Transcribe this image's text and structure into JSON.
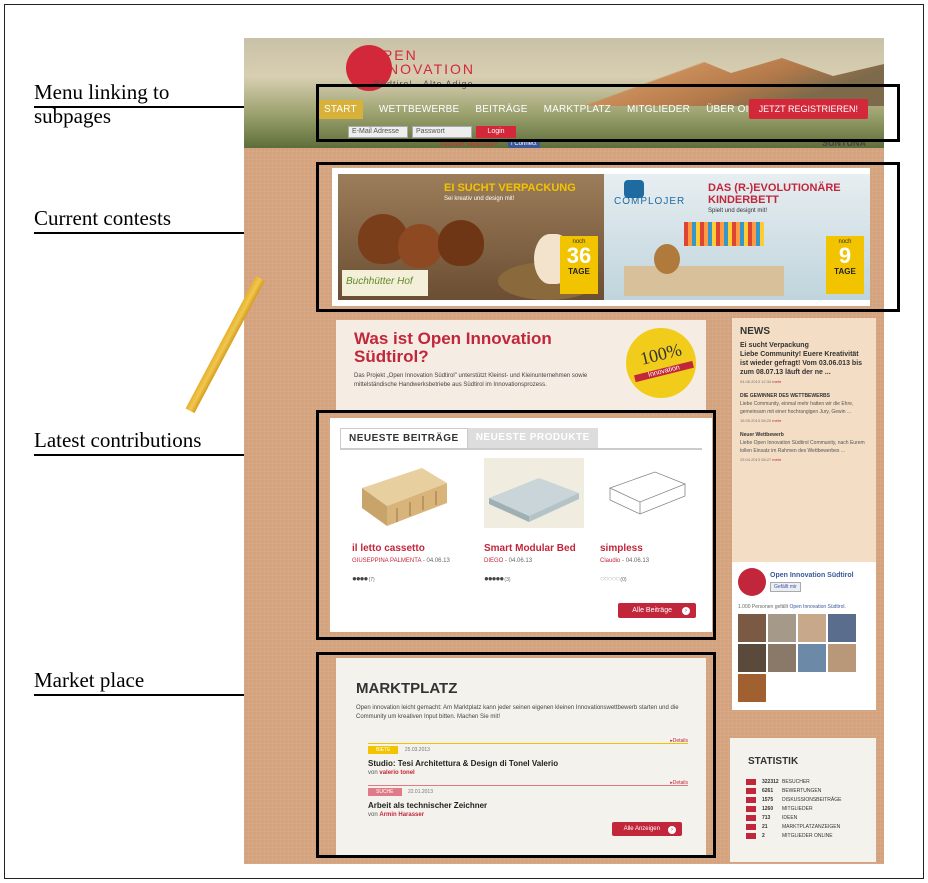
{
  "callouts": {
    "menu": "Menu linking to subpages",
    "contests": "Current contests",
    "contributions": "Latest contributions",
    "market": "Market place"
  },
  "header": {
    "logo_line1": "OPEN",
    "logo_line2": "INNOVATION",
    "logo_sub": "Südtirol - Alto Adige",
    "nav": [
      "START",
      "WETTBEWERBE",
      "BEITRÄGE",
      "MARKTPLATZ",
      "MITGLIEDER",
      "ÜBER OIS"
    ],
    "register": "JETZT REGISTRIEREN!",
    "email_placeholder": "E-Mail Adresse",
    "password_placeholder": "Passwort",
    "login": "Login",
    "forgot": "Passwort vergessen?",
    "connect": "Connect",
    "sponsor": "SUNTUNA"
  },
  "contests": [
    {
      "title": "EI SUCHT VERPACKUNG",
      "subtitle": "Sei kreativ und design mit!",
      "noch": "noch",
      "days": "36",
      "tage": "TAGE",
      "brand": "Buchhütter Hof"
    },
    {
      "title": "DAS (R-)EVOLUTIONÄRE KINDERBETT",
      "subtitle": "Spielt und designt mit!",
      "noch": "noch",
      "days": "9",
      "tage": "TAGE",
      "brand": "COMPLOJER"
    }
  ],
  "about": {
    "title": "Was ist Open Innovation Südtirol?",
    "text": "Das Projekt „Open Innovation Südtirol\" unterstützt Kleinst- und Kleinunternehmen sowie mittelständische Handwerksbetriebe aus Südtirol im Innovationsprozess.",
    "badge_num": "100%",
    "badge_sub": "Innovation"
  },
  "latest": {
    "tab_active": "NEUESTE BEITRÄGE",
    "tab_inactive": "NEUESTE PRODUKTE",
    "entries": [
      {
        "title": "il letto cassetto",
        "author": "GIUSEPPINA PALMENTA",
        "date": "- 04.06.13",
        "dots": "●●●●",
        "count": "(7)"
      },
      {
        "title": "Smart Modular Bed",
        "author": "DIEGO",
        "date": "- 04.06.13",
        "dots": "●●●●●",
        "count": "(3)"
      },
      {
        "title": "simpless",
        "author": "Claudio",
        "date": "- 04.06.13",
        "dots": "○○○○○",
        "count": "(0)"
      }
    ],
    "all_button": "Alle Beiträge"
  },
  "news": {
    "heading": "NEWS",
    "items": [
      {
        "title": "Ei sucht Verpackung",
        "body": "Liebe Community! Euere Kreativität ist wieder gefragt! Vom 03.06.013 bis zum 08.07.13 läuft der ne ...",
        "date": "04.06.2013 12:34",
        "more": "mehr"
      },
      {
        "title": "DIE GEWINNER DES WETTBEWERBS",
        "body": "Liebe Community, einmal mehr hatten wir die Ehre, gemeinsam mit einer hochrangigen Jury, Gewin ...",
        "date": "16.05.2013 08:20",
        "more": "mehr"
      },
      {
        "title": "Neuer Wettbewerb",
        "body": "Liebe Open Innovation Südtirol Community, nach Eurem tollen Einsatz im Rahmen des Wettbewerbes ...",
        "date": "25.04.2013 08:27",
        "more": "mehr"
      }
    ]
  },
  "facebook": {
    "name": "Open Innovation Südtirol",
    "like": "Gefällt mir",
    "count_text": "1.000 Personen gefällt",
    "count_link": "Open Innovation Südtirol."
  },
  "market": {
    "title": "MARKTPLATZ",
    "text": "Open innovation leicht gemacht: Am Marktplatz kann jeder seinen eigenen kleinen Innovationswettbewerb starten und die Community um kreativen Input bitten. Machen Sie mit!",
    "items": [
      {
        "tag": "BIETE",
        "date": "25.03.2013",
        "details": "▸Details",
        "title": "Studio: Tesi Architettura & Design di Tonel Valerio",
        "by": "von",
        "author": "valerio tonel"
      },
      {
        "tag": "SUCHE",
        "date": "22.01.2013",
        "details": "▸Details",
        "title": "Arbeit als technischer Zeichner",
        "by": "von",
        "author": "Armin Harasser"
      }
    ],
    "button": "Alle Anzeigen"
  },
  "stats": {
    "heading": "STATISTIK",
    "rows": [
      {
        "value": "322312",
        "label": "BESUCHER"
      },
      {
        "value": "6261",
        "label": "BEWERTUNGEN"
      },
      {
        "value": "1575",
        "label": "DISKUSSIONSBEITRÄGE"
      },
      {
        "value": "1260",
        "label": "MITGLIEDER"
      },
      {
        "value": "713",
        "label": "IDEEN"
      },
      {
        "value": "21",
        "label": "MARKTPLATZANZEIGEN"
      },
      {
        "value": "2",
        "label": "MITGLIEDER ONLINE"
      }
    ]
  }
}
